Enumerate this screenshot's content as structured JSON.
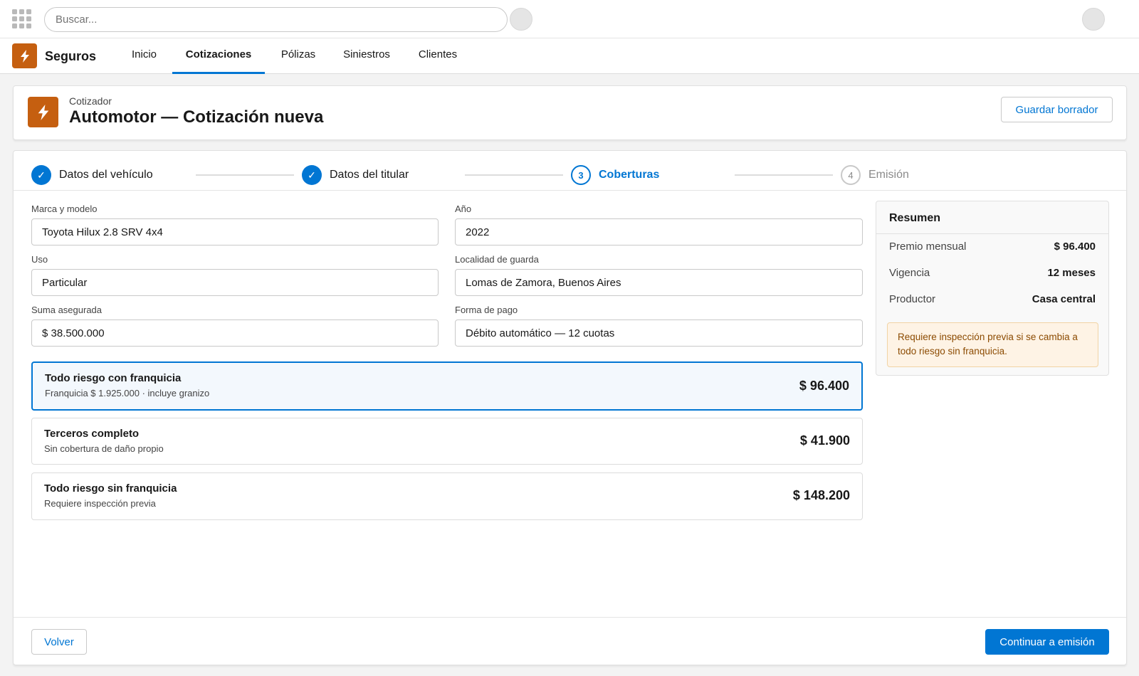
{
  "topbar": {
    "search_placeholder": "Buscar...",
    "icons": [
      "app-launcher-icon",
      "help-icon",
      "user-avatar"
    ]
  },
  "app": {
    "name": "Seguros",
    "icon": "bolt-icon",
    "tabs": [
      {
        "label": "Inicio",
        "active": false
      },
      {
        "label": "Cotizaciones",
        "active": true
      },
      {
        "label": "Pólizas",
        "active": false
      },
      {
        "label": "Siniestros",
        "active": false
      },
      {
        "label": "Clientes",
        "active": false
      }
    ]
  },
  "header": {
    "eyebrow": "Cotizador",
    "title": "Automotor — Cotización nueva",
    "save_draft_label": "Guardar borrador"
  },
  "stepper": {
    "steps": [
      {
        "marker": "✓",
        "label": "Datos del vehículo",
        "state": "done"
      },
      {
        "marker": "✓",
        "label": "Datos del titular",
        "state": "done"
      },
      {
        "marker": "3",
        "label": "Coberturas",
        "state": "current"
      },
      {
        "marker": "4",
        "label": "Emisión",
        "state": "todo"
      }
    ]
  },
  "form": {
    "brand_model": {
      "label": "Marca y modelo",
      "value": "Toyota Hilux 2.8 SRV 4x4"
    },
    "year": {
      "label": "Año",
      "value": "2022"
    },
    "use": {
      "label": "Uso",
      "value": "Particular"
    },
    "location": {
      "label": "Localidad de guarda",
      "value": "Lomas de Zamora, Buenos Aires"
    },
    "sum_insured": {
      "label": "Suma asegurada",
      "value": "$ 38.500.000"
    },
    "payment": {
      "label": "Forma de pago",
      "value": "Débito automático — 12 cuotas"
    }
  },
  "coverages": [
    {
      "title": "Todo riesgo con franquicia",
      "subtitle": "Franquicia $ 1.925.000 · incluye granizo",
      "price": "$ 96.400",
      "selected": true
    },
    {
      "title": "Terceros completo",
      "subtitle": "Sin cobertura de daño propio",
      "price": "$ 41.900",
      "selected": false
    },
    {
      "title": "Todo riesgo sin franquicia",
      "subtitle": "Requiere inspección previa",
      "price": "$ 148.200",
      "selected": false
    }
  ],
  "summary": {
    "title": "Resumen",
    "rows": [
      {
        "key": "Premio mensual",
        "value": "$ 96.400"
      },
      {
        "key": "Vigencia",
        "value": "12 meses"
      },
      {
        "key": "Productor",
        "value": "Casa central"
      }
    ],
    "warning": "Requiere inspección previa si se cambia a todo riesgo sin franquicia."
  },
  "footer": {
    "back_label": "Volver",
    "continue_label": "Continuar a emisión"
  },
  "colors": {
    "brand": "#0176d3",
    "app_icon": "#c55f10",
    "warning_bg": "#fef3e5",
    "warning_text": "#8c4b02"
  }
}
